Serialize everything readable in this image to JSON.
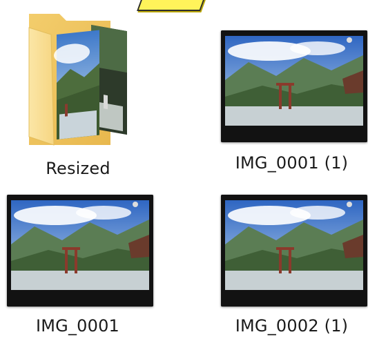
{
  "items": [
    {
      "name": "Resized",
      "type": "folder",
      "icon": "folder-icon"
    },
    {
      "name": "IMG_0001 (1)",
      "type": "image",
      "icon": "photo-thumbnail"
    },
    {
      "name": "IMG_0001",
      "type": "image",
      "icon": "photo-thumbnail"
    },
    {
      "name": "IMG_0002 (1)",
      "type": "image",
      "icon": "photo-thumbnail"
    }
  ],
  "colors": {
    "folder_yellow": "#f7d57a",
    "callout_yellow": "#fff35a",
    "label_text": "#1a1a1a"
  }
}
